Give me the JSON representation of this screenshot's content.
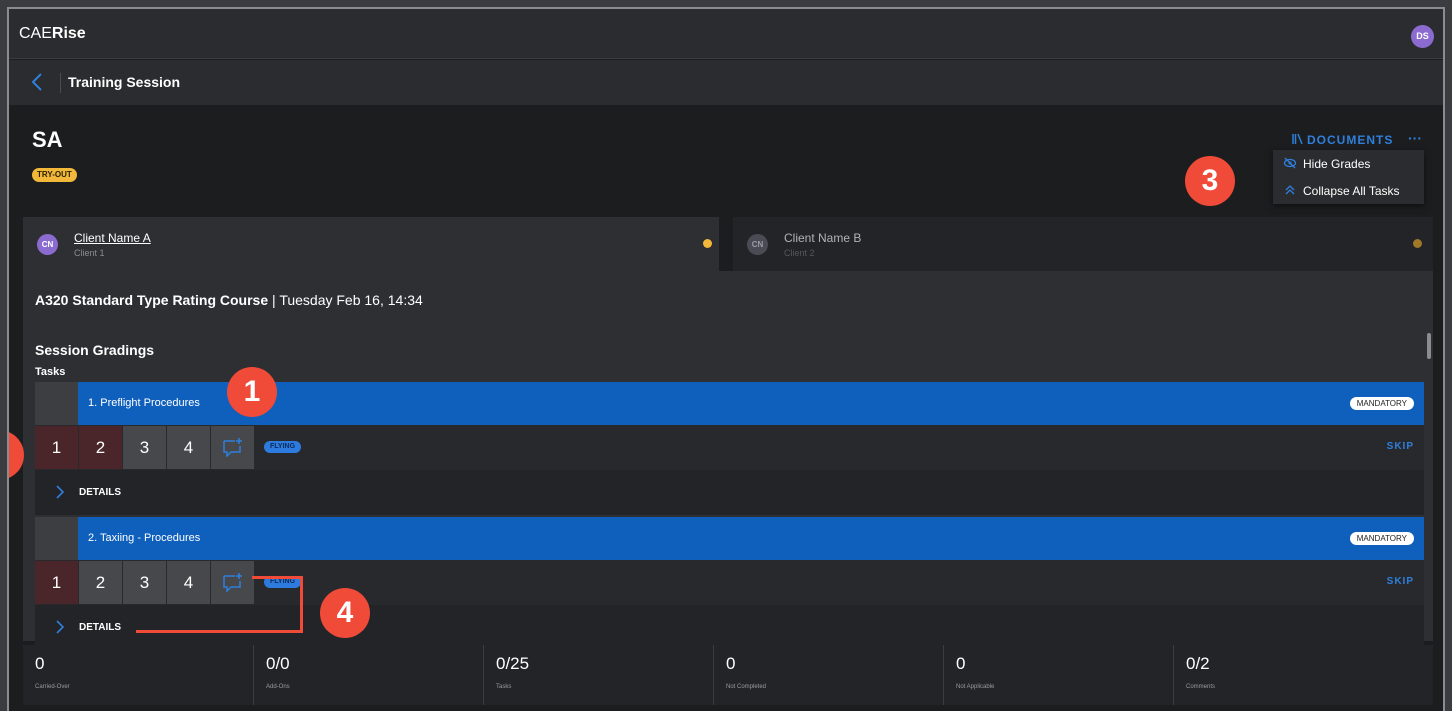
{
  "app": {
    "brand_prefix": "CAE",
    "brand_suffix": "Rise",
    "user_initials": "DS"
  },
  "subheader": {
    "title": "Training Session"
  },
  "session": {
    "title": "SA",
    "badge": "TRY-OUT"
  },
  "actions": {
    "documents_label": "DOCUMENTS",
    "more_label": "···"
  },
  "menu": {
    "items": [
      {
        "label": "Hide Grades",
        "icon": "eye-slash-icon"
      },
      {
        "label": "Collapse All Tasks",
        "icon": "double-chevron-up-icon"
      }
    ]
  },
  "callouts": [
    "1",
    "2",
    "3",
    "4"
  ],
  "clients": [
    {
      "initials": "CN",
      "name": "Client Name A",
      "sub": "Client 1",
      "status_color": "#f2b83a"
    },
    {
      "initials": "CN",
      "name": "Client Name B",
      "sub": "Client 2",
      "status_color": "#a07828"
    }
  ],
  "course": {
    "name": "A320 Standard Type Rating Course",
    "separator": "|",
    "date": "Tuesday Feb 16, 14:34"
  },
  "gradings": {
    "title": "Session Gradings",
    "tasks_label": "Tasks"
  },
  "tasks": [
    {
      "name": "1. Preflight Procedures",
      "tag": "MANDATORY",
      "grades": [
        "1",
        "2",
        "3",
        "4"
      ],
      "category": "FLYING",
      "skip": "SKIP",
      "details": "DETAILS"
    },
    {
      "name": "2. Taxiing - Procedures",
      "tag": "MANDATORY",
      "grades": [
        "1",
        "2",
        "3",
        "4"
      ],
      "category": "FLYING",
      "skip": "SKIP",
      "details": "DETAILS"
    }
  ],
  "stats": [
    {
      "value": "0",
      "label": "Carried-Over"
    },
    {
      "value": "0/0",
      "label": "Add-Ons"
    },
    {
      "value": "0/25",
      "label": "Tasks"
    },
    {
      "value": "0",
      "label": "Not Completed"
    },
    {
      "value": "0",
      "label": "Not Applicable"
    },
    {
      "value": "0/2",
      "label": "Comments"
    }
  ],
  "colors": {
    "accent": "#2f7fdc",
    "task_header": "#0f5fbd",
    "callout": "#f04a38",
    "tryout": "#f2b83a"
  }
}
